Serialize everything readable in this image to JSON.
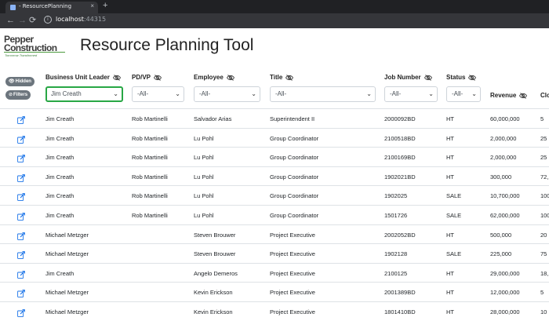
{
  "browser": {
    "tab_title": "- ResourcePlanning",
    "tab_close": "×",
    "new_tab": "+",
    "info_glyph": "i",
    "url_host": "localhost",
    "url_port": ":44315",
    "back": "←",
    "forward": "→",
    "reload": "⟳"
  },
  "logo": {
    "line1": "Pepper",
    "line2": "Construction",
    "tagline": "Tomorrow Transformed"
  },
  "page": {
    "title": "Resource Planning Tool"
  },
  "buttons": {
    "hidden": "Hidden",
    "filters": "Filters"
  },
  "columns": [
    {
      "label": "Business Unit Leader",
      "filter_value": "Jim Creath"
    },
    {
      "label": "PD/VP",
      "filter_value": "-All-"
    },
    {
      "label": "Employee",
      "filter_value": "-All-"
    },
    {
      "label": "Title",
      "filter_value": "-All-"
    },
    {
      "label": "Job Number",
      "filter_value": "-All-"
    },
    {
      "label": "Status",
      "filter_value": "-All-"
    },
    {
      "label": "Revenue"
    },
    {
      "label": "Clo"
    }
  ],
  "rows": [
    [
      "Jim Creath",
      "Rob Martinelli",
      "Salvador Arias",
      "Superintendent II",
      "2000092BD",
      "HT",
      "60,000,000",
      "5"
    ],
    [
      "Jim Creath",
      "Rob Martinelli",
      "Lu Pohl",
      "Group Coordinator",
      "2100518BD",
      "HT",
      "2,000,000",
      "25"
    ],
    [
      "Jim Creath",
      "Rob Martinelli",
      "Lu Pohl",
      "Group Coordinator",
      "2100169BD",
      "HT",
      "2,000,000",
      "25"
    ],
    [
      "Jim Creath",
      "Rob Martinelli",
      "Lu Pohl",
      "Group Coordinator",
      "1902021BD",
      "HT",
      "300,000",
      "72,"
    ],
    [
      "Jim Creath",
      "Rob Martinelli",
      "Lu Pohl",
      "Group Coordinator",
      "1902025",
      "SALE",
      "10,700,000",
      "100"
    ],
    [
      "Jim Creath",
      "Rob Martinelli",
      "Lu Pohl",
      "Group Coordinator",
      "1501726",
      "SALE",
      "62,000,000",
      "100"
    ],
    [
      "Michael Metzger",
      "Steven Brouwer",
      "Project Executive",
      "",
      "2002052BD",
      "HT",
      "500,000",
      "20"
    ],
    [
      "Michael Metzger",
      "Steven Brouwer",
      "Project Executive",
      "",
      "1902128",
      "SALE",
      "225,000",
      "75"
    ],
    [
      "Jim Creath",
      "Angelo Demeros",
      "Project Executive",
      "",
      "2100125",
      "HT",
      "29,000,000",
      "18,"
    ],
    [
      "Michael Metzger",
      "Kevin Erickson",
      "Project Executive",
      "",
      "2001389BD",
      "HT",
      "12,000,000",
      "5"
    ],
    [
      "Michael Metzger",
      "Kevin Erickson",
      "Project Executive",
      "",
      "1801410BD",
      "HT",
      "28,000,000",
      "10"
    ]
  ],
  "colors": {
    "accent_green": "#28a745",
    "edit_icon": "#1a73e8",
    "pill_bg": "#6c757d"
  },
  "icons": {
    "edit": "edit-icon",
    "hide_column": "eye-slash-icon",
    "hidden": "eye-icon",
    "filters": "filter-icon"
  }
}
